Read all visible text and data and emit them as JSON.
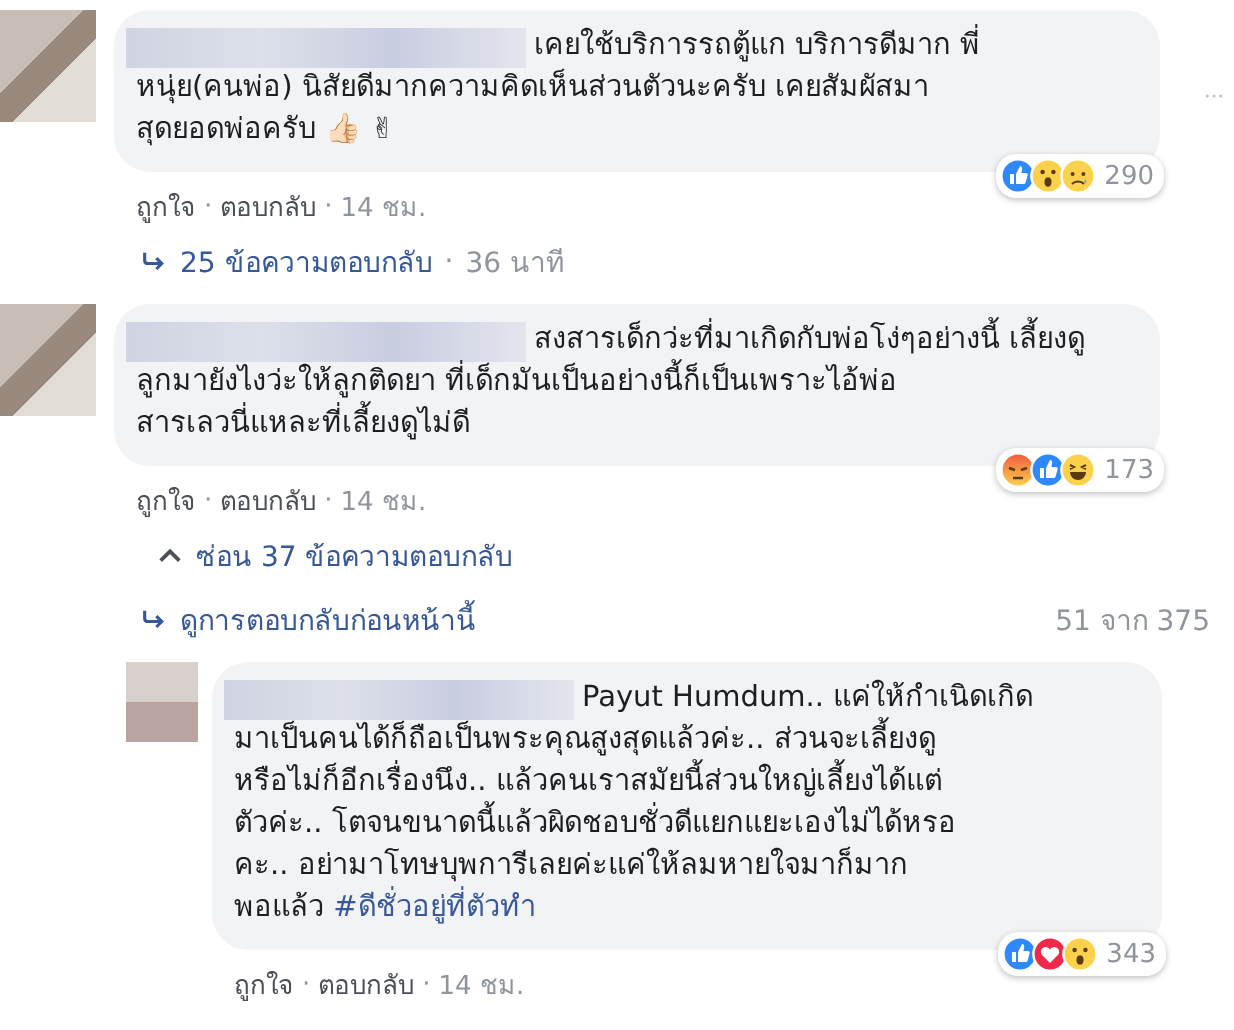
{
  "comments": [
    {
      "lead": "เคยใช้บริการรถตู้แก บริการดีมาก พี่",
      "text": "หนุ่ย(คนพ่อ) นิสัยดีมากความคิดเห็นส่วนตัวนะครับ เคยสัมผัสมา\nสุดยอดพ่อครับ 👍🏻 ✌",
      "reactions": [
        {
          "kind": "like"
        },
        {
          "kind": "wow"
        },
        {
          "kind": "sad"
        }
      ],
      "reaction_count": "290",
      "menu_visible": true,
      "actions": [
        {
          "kind": "like",
          "label": "ถูกใจ"
        },
        {
          "kind": "separator",
          "label": "·"
        },
        {
          "kind": "reply",
          "label": "ตอบกลับ"
        },
        {
          "kind": "separator",
          "label": "·"
        },
        {
          "kind": "time",
          "label": "14 ชม."
        }
      ],
      "reply_links": [
        {
          "kind": "expand",
          "label": "25 ข้อความตอบกลับ",
          "separator": "·",
          "time": "36 นาที"
        }
      ]
    },
    {
      "lead": "สงสารเด็กว่ะที่มาเกิดกับพ่อโง่ๆอย่างนี้ เลี้ยงดู",
      "text": "ลูกมายังไงว่ะให้ลูกติดยา ที่เด็กมันเป็นอย่างนี้ก็เป็นเพราะไอ้พ่อ\nสารเลวนี่แหละที่เลี้ยงดูไม่ดี",
      "reactions": [
        {
          "kind": "angry"
        },
        {
          "kind": "like"
        },
        {
          "kind": "haha"
        }
      ],
      "reaction_count": "173",
      "menu_visible": false,
      "actions": [
        {
          "kind": "like",
          "label": "ถูกใจ"
        },
        {
          "kind": "separator",
          "label": "·"
        },
        {
          "kind": "reply",
          "label": "ตอบกลับ"
        },
        {
          "kind": "separator",
          "label": "·"
        },
        {
          "kind": "time",
          "label": "14 ชม."
        }
      ],
      "reply_links": [
        {
          "kind": "collapse",
          "label": "ซ่อน 37 ข้อความตอบกลับ"
        },
        {
          "kind": "previous",
          "label": "ดูการตอบกลับก่อนหน้านี้",
          "count": "51 จาก 375"
        }
      ],
      "replies": [
        {
          "lead": "Payut Humdum.. แค่ให้กำเนิดเกิด",
          "text": "มาเป็นคนได้ก็ถือเป็นพระคุณสูงสุดแล้วค่ะ.. ส่วนจะเลี้ยงดู\nหรือไม่ก็อีกเรื่องนึง.. แล้วคนเราสมัยนี้ส่วนใหญ่เลี้ยงได้แต่\nตัวค่ะ.. โตจนขนาดนี้แล้วผิดชอบชั่วดีแยกแยะเองไม่ได้หรอ\nคะ.. อย่ามาโทษบุพการีเลยค่ะแค่ให้ลมหายใจมาก็มาก\nพอแล้ว",
          "hashtag": "#ดีชั่วอยู่ที่ตัวทำ",
          "reactions": [
            {
              "kind": "like"
            },
            {
              "kind": "love"
            },
            {
              "kind": "wow"
            }
          ],
          "reaction_count": "343",
          "menu_visible": false,
          "actions": [
            {
              "kind": "like",
              "label": "ถูกใจ"
            },
            {
              "kind": "separator",
              "label": "·"
            },
            {
              "kind": "reply",
              "label": "ตอบกลับ"
            },
            {
              "kind": "separator",
              "label": "·"
            },
            {
              "kind": "time",
              "label": "14 ชม."
            }
          ]
        }
      ]
    }
  ]
}
